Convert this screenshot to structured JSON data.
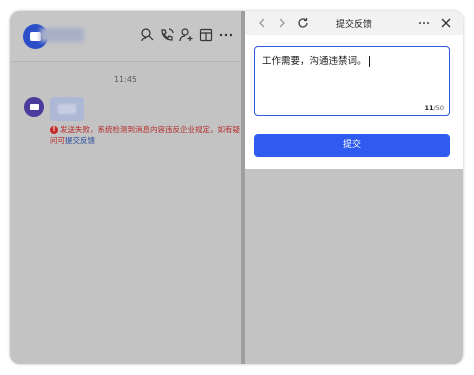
{
  "left_pane": {
    "message_time": "11:45",
    "error": {
      "icon": "error-icon",
      "text": "发送失败，系统检测到消息内容违反企业规定，如有疑问可",
      "link": "提交反馈"
    }
  },
  "header_icons": [
    "search-person-icon",
    "call-icon",
    "add-member-icon",
    "window-icon",
    "more-icon"
  ],
  "feedback_panel": {
    "title": "提交反馈",
    "textarea_value": "工作需要，沟通违禁词。",
    "counter_current": "11",
    "counter_max": "/50",
    "submit_label": "提交"
  },
  "colors": {
    "accent": "#2f5bf0",
    "error": "#c62828",
    "link": "#23479e"
  }
}
